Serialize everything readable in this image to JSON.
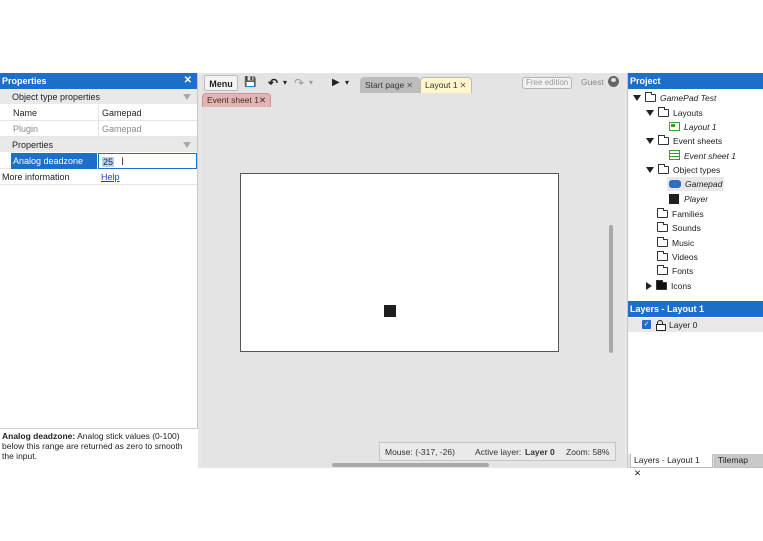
{
  "properties_panel": {
    "title": "Properties",
    "close_glyph": "✕",
    "section_object_type": "Object type properties",
    "rows": [
      {
        "key": "Name",
        "value": "Gamepad"
      },
      {
        "key": "Plugin",
        "value": "Gamepad"
      }
    ],
    "section_properties": "Properties",
    "analog_key": "Analog deadzone",
    "analog_value": "25",
    "more_info_key": "More information",
    "more_info_link": "Help",
    "description_bold": "Analog deadzone:",
    "description_text": " Analog stick values (0-100) below this range are returned as zero to smooth the input."
  },
  "toolbar": {
    "menu_label": "Menu",
    "save_glyph": "💾",
    "undo_glyph": "↶",
    "redo_glyph": "↷",
    "play_glyph": "▶",
    "dropdown_glyph": "▾",
    "tabs": [
      {
        "label": "Start page",
        "close": "✕"
      },
      {
        "label": "Layout 1",
        "close": "✕"
      }
    ],
    "free_edition": "Free edition",
    "guest": "Guest"
  },
  "event_tab": {
    "label": "Event sheet 1",
    "close": "✕"
  },
  "statusbar": {
    "mouse": "Mouse: (-317, -26)",
    "active_layer_label": "Active layer: ",
    "active_layer_value": "Layer 0",
    "zoom": "Zoom: 58%"
  },
  "project_panel": {
    "title": "Project",
    "root": "GamePad Test",
    "layouts": "Layouts",
    "layout_1": "Layout 1",
    "event_sheets": "Event sheets",
    "event_sheet_1": "Event sheet 1",
    "object_types": "Object types",
    "obj_gamepad": "Gamepad",
    "obj_player": "Player",
    "families": "Families",
    "sounds": "Sounds",
    "music": "Music",
    "videos": "Videos",
    "fonts": "Fonts",
    "icons": "Icons"
  },
  "layers_panel": {
    "title": "Layers - Layout 1",
    "layer_name": "Layer 0",
    "check_glyph": "✓"
  },
  "bottom_tabs": {
    "layers_label": "Layers - Layout 1",
    "layers_close": "✕",
    "tilemap_label": "Tilemap"
  },
  "colors": {
    "accent": "#1d6fc8",
    "tab_active": "#fff6c9",
    "event_tab": "#e6b3b3"
  }
}
